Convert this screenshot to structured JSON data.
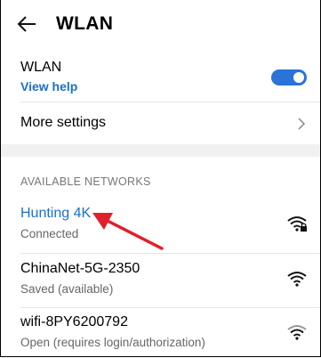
{
  "header": {
    "title": "WLAN"
  },
  "wlan": {
    "label": "WLAN",
    "help": "View help",
    "toggle_on": true
  },
  "more_settings": {
    "label": "More settings"
  },
  "available": {
    "section_title": "AVAILABLE NETWORKS",
    "networks": [
      {
        "name": "Hunting 4K",
        "status": "Connected",
        "icon": "wifi-lock-icon",
        "active": true
      },
      {
        "name": "ChinaNet-5G-2350",
        "status": "Saved (available)",
        "icon": "wifi-icon",
        "active": false
      },
      {
        "name": "wifi-8PY6200792",
        "status": "Open (requires login/authorization)",
        "icon": "wifi-icon",
        "active": false
      }
    ]
  },
  "colors": {
    "accent": "#1b70c8",
    "toggle": "#2a73d9",
    "annotation_arrow": "#e0202a"
  }
}
